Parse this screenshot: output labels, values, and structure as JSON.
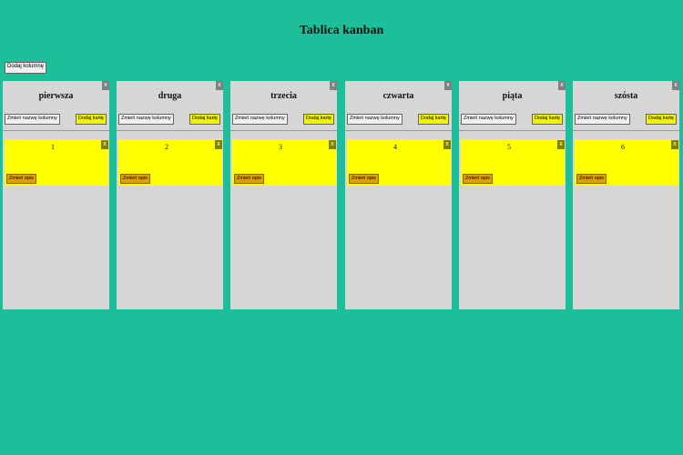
{
  "board": {
    "title": "Tablica kanban",
    "add_column_label": "Dodaj kolumnę"
  },
  "columns": [
    {
      "title": "pierwsza",
      "close_label": "x",
      "rename_label": "Zmień nazwę kolumny",
      "add_card_label": "Dodaj kartę",
      "cards": [
        {
          "text": "1",
          "close_label": "x",
          "edit_label": "Zmień opis"
        }
      ]
    },
    {
      "title": "druga",
      "close_label": "x",
      "rename_label": "Zmień nazwę kolumny",
      "add_card_label": "Dodaj kartę",
      "cards": [
        {
          "text": "2",
          "close_label": "x",
          "edit_label": "Zmień opis"
        }
      ]
    },
    {
      "title": "trzecia",
      "close_label": "x",
      "rename_label": "Zmień nazwę kolumny",
      "add_card_label": "Dodaj kartę",
      "cards": [
        {
          "text": "3",
          "close_label": "x",
          "edit_label": "Zmień opis"
        }
      ]
    },
    {
      "title": "czwarta",
      "close_label": "x",
      "rename_label": "Zmień nazwę kolumny",
      "add_card_label": "Dodaj kartę",
      "cards": [
        {
          "text": "4",
          "close_label": "x",
          "edit_label": "Zmień opis"
        }
      ]
    },
    {
      "title": "piąta",
      "close_label": "x",
      "rename_label": "Zmień nazwę kolumny",
      "add_card_label": "Dodaj kartę",
      "cards": [
        {
          "text": "5",
          "close_label": "x",
          "edit_label": "Zmień opis"
        }
      ]
    },
    {
      "title": "szósta",
      "close_label": "x",
      "rename_label": "Zmień nazwę kolumny",
      "add_card_label": "Dodaj kartę",
      "cards": [
        {
          "text": "6",
          "close_label": "x",
          "edit_label": "Zmień opis"
        }
      ]
    }
  ],
  "colors": {
    "background": "#1dbf9a",
    "column": "#d6d6d6",
    "card": "#ffff00",
    "add_card_button": "#f4f400",
    "edit_description_button": "#e0a000"
  }
}
